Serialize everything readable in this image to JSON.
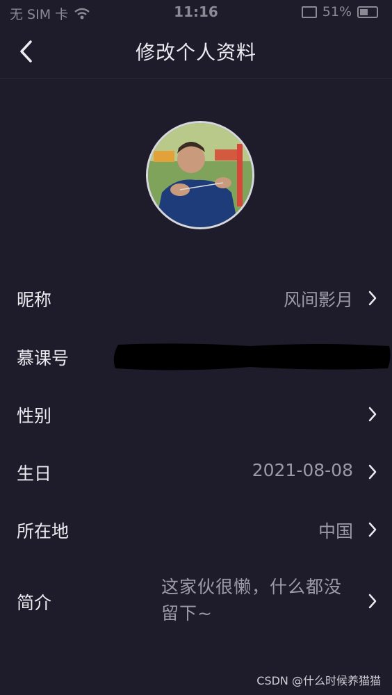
{
  "status_bar": {
    "carrier": "无 SIM 卡",
    "time": "11:16",
    "battery": "51%"
  },
  "nav": {
    "title": "修改个人资料"
  },
  "rows": {
    "nickname": {
      "label": "昵称",
      "value": "风间影月"
    },
    "mooc_id": {
      "label": "慕课号",
      "value": ""
    },
    "gender": {
      "label": "性别",
      "value": ""
    },
    "birthday": {
      "label": "生日",
      "value": "2021-08-08"
    },
    "location": {
      "label": "所在地",
      "value": "中国"
    },
    "bio": {
      "label": "简介",
      "value": "这家伙很懒，什么都没留下~"
    }
  },
  "watermark": "CSDN @什么时候养猫猫",
  "icons": {
    "back": "chevron-left-icon",
    "row_arrow": "chevron-right-icon",
    "wifi": "wifi-icon",
    "battery": "battery-icon",
    "airplay": "screen-mirror-icon"
  },
  "colors": {
    "background": "#1e1b2b",
    "primary_text": "#ecebf0",
    "secondary_text": "#9d9aa7"
  }
}
